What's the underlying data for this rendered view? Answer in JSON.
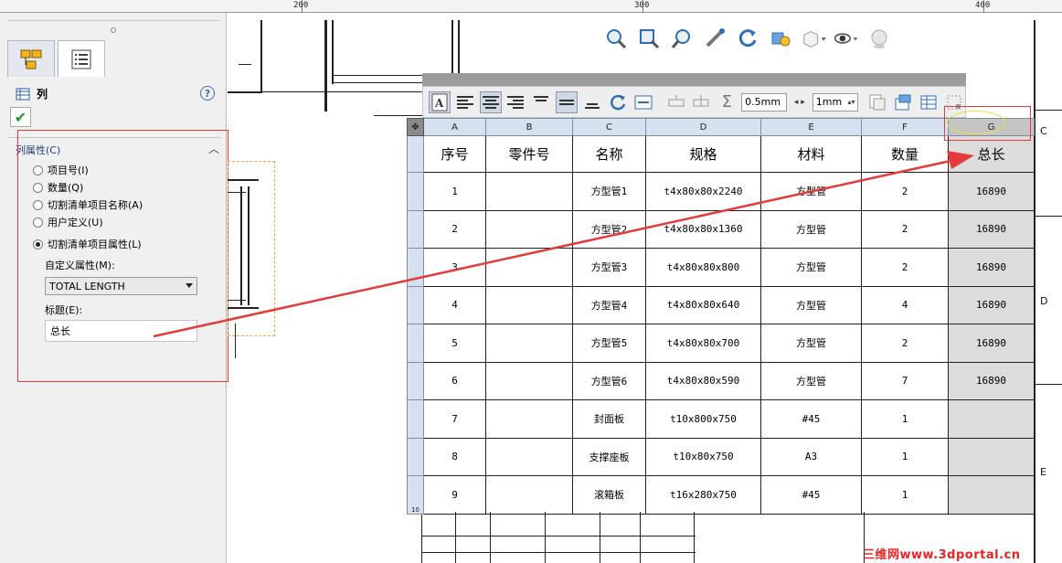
{
  "ruler": {
    "labels": [
      "200",
      "300",
      "400"
    ]
  },
  "panel": {
    "title": "列",
    "group_header": "列属性(C)",
    "radio_options": [
      {
        "label": "项目号(I)",
        "selected": false
      },
      {
        "label": "数量(Q)",
        "selected": false
      },
      {
        "label": "切割清单项目名称(A)",
        "selected": false
      },
      {
        "label": "用户定义(U)",
        "selected": false
      },
      {
        "label": "切割清单项目属性(L)",
        "selected": true
      }
    ],
    "custom_property_label": "自定义属性(M):",
    "custom_property_value": "TOTAL LENGTH",
    "title_label": "标题(E):",
    "title_value": "总长"
  },
  "table_toolbar": {
    "border_width_1": "0.5mm",
    "border_width_2": "1mm"
  },
  "table": {
    "column_letters": [
      "A",
      "B",
      "C",
      "D",
      "E",
      "F",
      "G"
    ],
    "headers": [
      "序号",
      "零件号",
      "名称",
      "规格",
      "材料",
      "数量",
      "总长"
    ],
    "rows": [
      [
        "1",
        "",
        "方型管1",
        "t4x80x80x2240",
        "方型管",
        "2",
        "16890"
      ],
      [
        "2",
        "",
        "方型管2",
        "t4x80x80x1360",
        "方型管",
        "2",
        "16890"
      ],
      [
        "3",
        "",
        "方型管3",
        "t4x80x80x800",
        "方型管",
        "2",
        "16890"
      ],
      [
        "4",
        "",
        "方型管4",
        "t4x80x80x640",
        "方型管",
        "4",
        "16890"
      ],
      [
        "5",
        "",
        "方型管5",
        "t4x80x80x700",
        "方型管",
        "2",
        "16890"
      ],
      [
        "6",
        "",
        "方型管6",
        "t4x80x80x590",
        "方型管",
        "7",
        "16890"
      ],
      [
        "7",
        "",
        "封面板",
        "t10x800x750",
        "#45",
        "1",
        ""
      ],
      [
        "8",
        "",
        "支撑座板",
        "t10x80x750",
        "A3",
        "1",
        ""
      ],
      [
        "9",
        "",
        "滚箱板",
        "t16x280x750",
        "#45",
        "1",
        ""
      ]
    ],
    "last_row_header": "10"
  },
  "zones": [
    "C",
    "D",
    "E"
  ],
  "watermark": "三维网www.3dportal.cn",
  "colors": {
    "highlight_red": "#e43a3a",
    "column_header_blue": "#d5e1ee",
    "selected_column_gray": "#dcdcdc",
    "check_green": "#1f9b2a"
  }
}
